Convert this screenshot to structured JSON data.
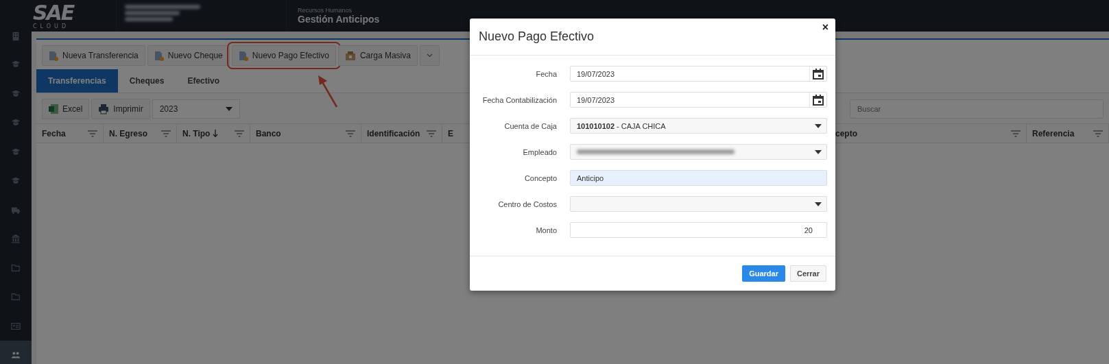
{
  "header": {
    "logo": {
      "mark": "SAE",
      "sub": "CLOUD"
    },
    "module": "Recursos Humanos",
    "title": "Gestión Anticipos"
  },
  "sidebar": {
    "items": [
      {
        "kind": "building",
        "selected": false
      },
      {
        "kind": "cap",
        "selected": false
      },
      {
        "kind": "cap",
        "selected": false
      },
      {
        "kind": "cap",
        "selected": false
      },
      {
        "kind": "cap",
        "selected": false
      },
      {
        "kind": "cap",
        "selected": false
      },
      {
        "kind": "truck",
        "selected": false
      },
      {
        "kind": "bank",
        "selected": false
      },
      {
        "kind": "folder",
        "selected": false
      },
      {
        "kind": "folder",
        "selected": false
      },
      {
        "kind": "card",
        "selected": false
      },
      {
        "kind": "users",
        "selected": true
      }
    ]
  },
  "toolbar": {
    "buttons": [
      {
        "label": "Nueva Transferencia",
        "kind": "doc",
        "highlighted": false
      },
      {
        "label": "Nuevo Cheque",
        "kind": "doc",
        "highlighted": false
      },
      {
        "label": "Nuevo Pago Efectivo",
        "kind": "doc",
        "highlighted": true
      },
      {
        "label": "Carga Masiva",
        "kind": "box",
        "highlighted": false
      },
      {
        "kind": "caret",
        "highlighted": false
      }
    ]
  },
  "tabs": [
    {
      "label": "Transferencias",
      "selected": true
    },
    {
      "label": "Cheques",
      "selected": false
    },
    {
      "label": "Efectivo",
      "selected": false
    }
  ],
  "grid_toolbar": {
    "buttons": [
      {
        "label": "Excel",
        "kind": "excel"
      },
      {
        "label": "Imprimir",
        "kind": "print"
      }
    ],
    "year": "2023",
    "search": {
      "placeholder": "Buscar"
    }
  },
  "table": {
    "columns": [
      {
        "label": "Fecha",
        "sorted": false
      },
      {
        "label": "N. Egreso",
        "sorted": false
      },
      {
        "label": "N. Tipo",
        "sorted": true
      },
      {
        "label": "Banco",
        "sorted": false
      },
      {
        "label": "Identificación",
        "sorted": false
      },
      {
        "label": "E",
        "sorted": false
      },
      {
        "label": "cepto",
        "sorted": false
      },
      {
        "label": "Referencia",
        "sorted": false
      }
    ]
  },
  "modal": {
    "title": "Nuevo Pago Efectivo",
    "close": "×",
    "fields": [
      {
        "label": "Fecha",
        "kind": "date",
        "value": "19/07/2023",
        "highlighted": false
      },
      {
        "label": "Fecha Contabilización",
        "kind": "date",
        "value": "19/07/2023",
        "highlighted": false
      },
      {
        "label": "Cuenta de Caja",
        "kind": "select",
        "value": "**101010102** - CAJA CHICA",
        "highlighted": false
      },
      {
        "label": "Empleado",
        "kind": "blurred-select",
        "highlighted": false
      },
      {
        "label": "Concepto",
        "kind": "text",
        "value": "Anticipo",
        "highlighted": true
      },
      {
        "label": "Centro de Costos",
        "kind": "select",
        "highlighted": false
      },
      {
        "label": "Monto",
        "kind": "number",
        "value": "20",
        "highlighted": false
      }
    ],
    "buttons": [
      {
        "label": "Guardar",
        "kind": "primary"
      },
      {
        "label": "Cerrar",
        "kind": "default"
      }
    ]
  }
}
